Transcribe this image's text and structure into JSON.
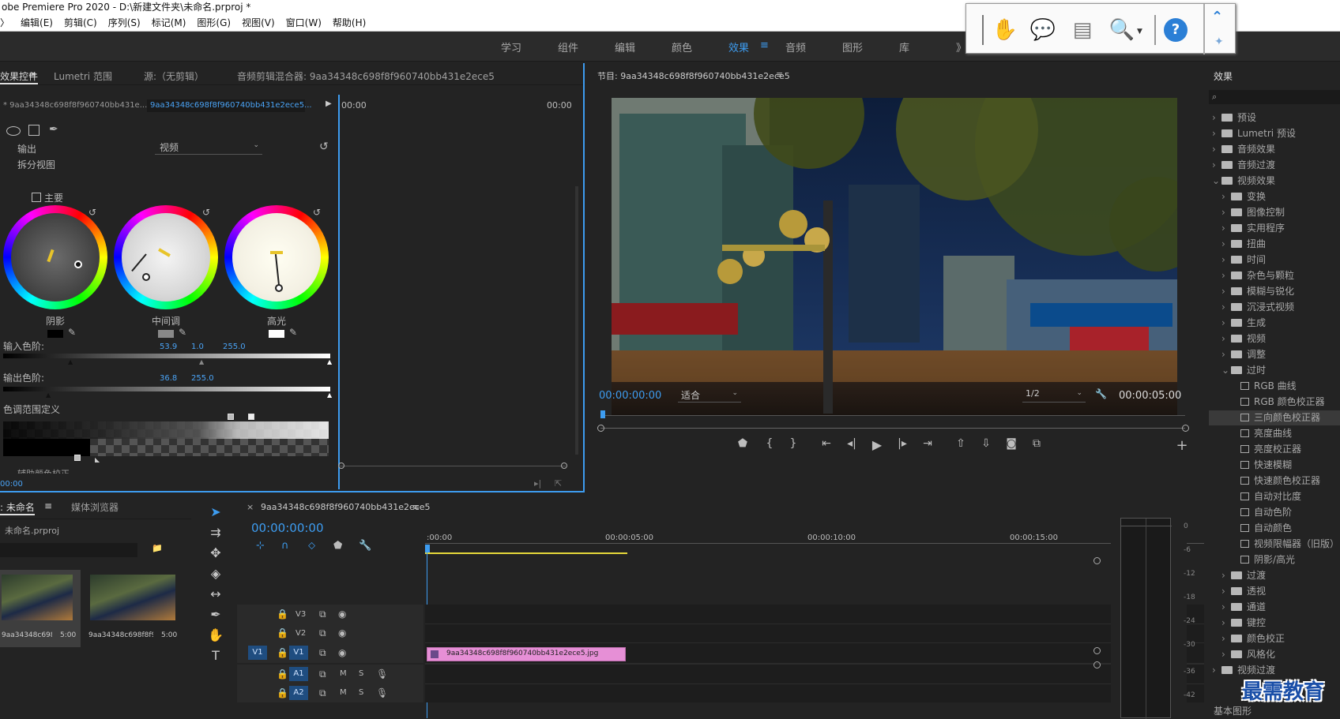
{
  "window": {
    "title": "obe Premiere Pro 2020 - D:\\新建文件夹\\未命名.prproj *"
  },
  "menu": [
    "〉",
    "编辑(E)",
    "剪辑(C)",
    "序列(S)",
    "标记(M)",
    "图形(G)",
    "视图(V)",
    "窗口(W)",
    "帮助(H)"
  ],
  "workspaces": [
    "学习",
    "组件",
    "编辑",
    "颜色",
    "效果",
    "音频",
    "图形",
    "库",
    "》"
  ],
  "active_workspace": "效果",
  "floating_toolbar": {
    "icons": [
      "hand-icon",
      "comment-icon",
      "document-icon",
      "search-page-icon",
      "help-icon",
      "collapse-icon",
      "pin-icon"
    ]
  },
  "source_panel": {
    "tabs": [
      "效果控件",
      "Lumetri 范围",
      "源:（无剪辑）",
      "音频剪辑混合器: 9aa34348c698f8f960740bb431e2ece5"
    ],
    "tab_menu": "≡",
    "clip_master": "* 9aa34348c698f8f960740bb431e...",
    "clip_seq": "9aa34348c698f8f960740bb431e2ece5...",
    "mini_time_start": "00:00",
    "mini_time_end": "00:00",
    "output_label": "输出",
    "output_value": "视频",
    "split_view": "拆分视图",
    "master_label": "主要",
    "wheels": [
      {
        "label": "阴影"
      },
      {
        "label": "中间调"
      },
      {
        "label": "高光"
      }
    ],
    "input_levels_label": "输入色阶:",
    "input_levels": [
      "53.9",
      "1.0",
      "255.0"
    ],
    "output_levels_label": "输出色阶:",
    "output_levels": [
      "36.8",
      "255.0"
    ],
    "tonal_range": "色调范围定义",
    "cut_text": "辅助颜色校正",
    "timecode": "00:00"
  },
  "program_monitor": {
    "title": "节目: 9aa34348c698f8f960740bb431e2ece5",
    "menu": "≡",
    "timecode_current": "00:00:00:00",
    "fit": "适合",
    "resolution": "1/2",
    "timecode_total": "00:00:05:00"
  },
  "project_panel": {
    "tabs": [
      "未命名",
      "媒体浏览器"
    ],
    "tab_menu": "≡",
    "file": "未命名.prproj",
    "thumbs": [
      {
        "name": "9aa34348c698f8f9...",
        "duration": "5:00"
      },
      {
        "name": "9aa34348c698f8f9...",
        "duration": "5:00"
      }
    ]
  },
  "timeline": {
    "close": "×",
    "title": "9aa34348c698f8f960740bb431e2ece5",
    "menu": "≡",
    "timecode": "00:00:00:00",
    "ruler": [
      ":00:00",
      "00:00:05:00",
      "00:00:10:00",
      "00:00:15:00"
    ],
    "tracks": [
      {
        "id": "V3",
        "target": ""
      },
      {
        "id": "V2",
        "target": ""
      },
      {
        "id": "V1",
        "target": "V1"
      },
      {
        "id": "A1",
        "target": ""
      },
      {
        "id": "A2",
        "target": ""
      }
    ],
    "clip_name": "9aa34348c698f8f960740bb431e2ece5.jpg",
    "audio_mute": "M",
    "audio_solo": "S"
  },
  "audio_meter": {
    "db": [
      "0",
      "-6",
      "-12",
      "-18",
      "-24",
      "-30",
      "-36",
      "-42"
    ]
  },
  "effects_panel": {
    "title": "效果",
    "items": [
      {
        "text": "预设",
        "indent": 0,
        "open": false,
        "type": "folder"
      },
      {
        "text": "Lumetri 预设",
        "indent": 0,
        "open": false,
        "type": "folder"
      },
      {
        "text": "音频效果",
        "indent": 0,
        "open": false,
        "type": "folder"
      },
      {
        "text": "音频过渡",
        "indent": 0,
        "open": false,
        "type": "folder"
      },
      {
        "text": "视频效果",
        "indent": 0,
        "open": true,
        "type": "folder"
      },
      {
        "text": "变换",
        "indent": 1,
        "open": false,
        "type": "folder"
      },
      {
        "text": "图像控制",
        "indent": 1,
        "open": false,
        "type": "folder"
      },
      {
        "text": "实用程序",
        "indent": 1,
        "open": false,
        "type": "folder"
      },
      {
        "text": "扭曲",
        "indent": 1,
        "open": false,
        "type": "folder"
      },
      {
        "text": "时间",
        "indent": 1,
        "open": false,
        "type": "folder"
      },
      {
        "text": "杂色与颗粒",
        "indent": 1,
        "open": false,
        "type": "folder"
      },
      {
        "text": "模糊与锐化",
        "indent": 1,
        "open": false,
        "type": "folder"
      },
      {
        "text": "沉浸式视频",
        "indent": 1,
        "open": false,
        "type": "folder"
      },
      {
        "text": "生成",
        "indent": 1,
        "open": false,
        "type": "folder"
      },
      {
        "text": "视频",
        "indent": 1,
        "open": false,
        "type": "folder"
      },
      {
        "text": "调整",
        "indent": 1,
        "open": false,
        "type": "folder"
      },
      {
        "text": "过时",
        "indent": 1,
        "open": true,
        "type": "folder"
      },
      {
        "text": "RGB 曲线",
        "indent": 2,
        "type": "preset"
      },
      {
        "text": "RGB 颜色校正器",
        "indent": 2,
        "type": "preset"
      },
      {
        "text": "三向颜色校正器",
        "indent": 2,
        "type": "preset",
        "selected": true
      },
      {
        "text": "亮度曲线",
        "indent": 2,
        "type": "preset"
      },
      {
        "text": "亮度校正器",
        "indent": 2,
        "type": "preset"
      },
      {
        "text": "快速模糊",
        "indent": 2,
        "type": "preset"
      },
      {
        "text": "快速颜色校正器",
        "indent": 2,
        "type": "preset"
      },
      {
        "text": "自动对比度",
        "indent": 2,
        "type": "preset"
      },
      {
        "text": "自动色阶",
        "indent": 2,
        "type": "preset"
      },
      {
        "text": "自动颜色",
        "indent": 2,
        "type": "preset"
      },
      {
        "text": "视频限幅器（旧版）",
        "indent": 2,
        "type": "preset"
      },
      {
        "text": "阴影/高光",
        "indent": 2,
        "type": "preset"
      },
      {
        "text": "过渡",
        "indent": 1,
        "open": false,
        "type": "folder"
      },
      {
        "text": "透视",
        "indent": 1,
        "open": false,
        "type": "folder"
      },
      {
        "text": "通道",
        "indent": 1,
        "open": false,
        "type": "folder"
      },
      {
        "text": "键控",
        "indent": 1,
        "open": false,
        "type": "folder"
      },
      {
        "text": "颜色校正",
        "indent": 1,
        "open": false,
        "type": "folder"
      },
      {
        "text": "风格化",
        "indent": 1,
        "open": false,
        "type": "folder"
      },
      {
        "text": "视频过渡",
        "indent": 0,
        "open": false,
        "type": "folder"
      }
    ],
    "footer": "基本图形"
  },
  "watermark": "最需教育",
  "colors": {
    "accent": "#3d9cf0",
    "clip": "#e68fd6",
    "track_target": "#1f4d80",
    "panel": "#232323"
  }
}
